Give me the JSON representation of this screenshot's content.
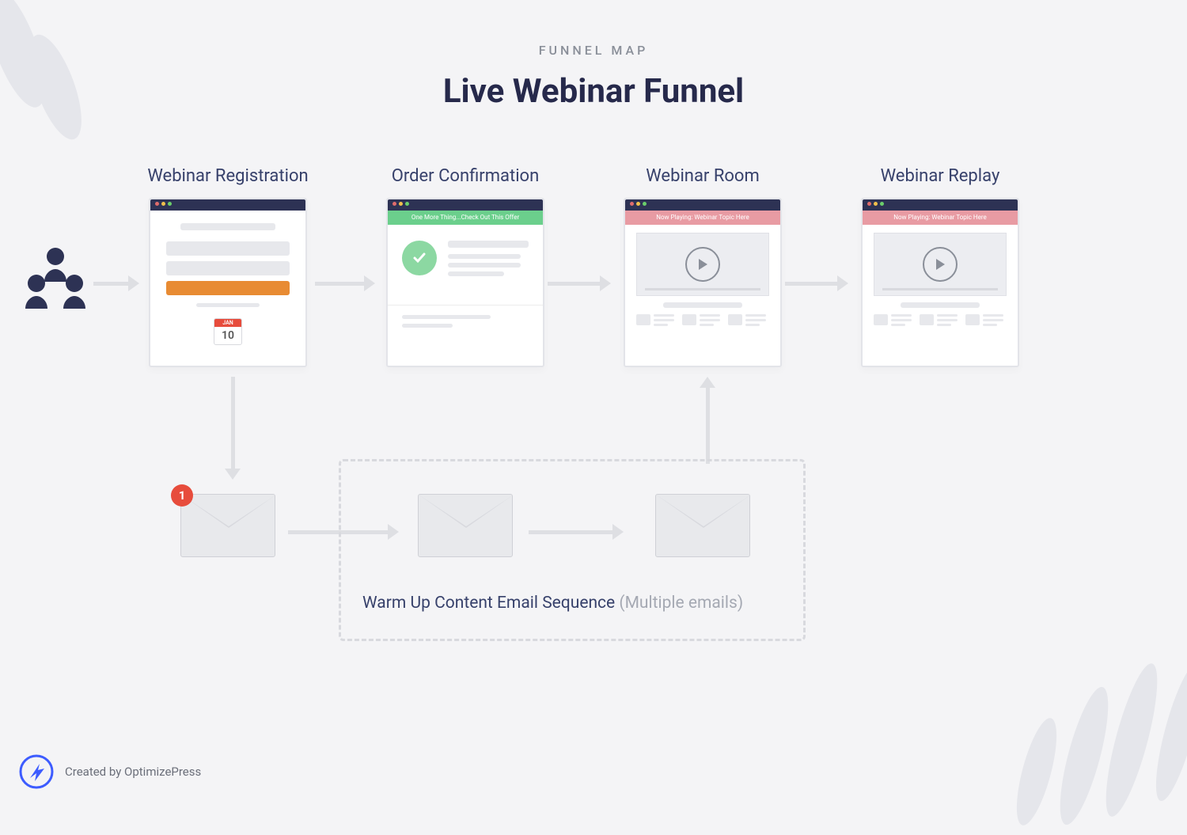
{
  "header": {
    "eyebrow": "FUNNEL MAP",
    "title": "Live Webinar Funnel"
  },
  "stages": {
    "registration": "Webinar Registration",
    "confirmation": "Order Confirmation",
    "room": "Webinar Room",
    "replay": "Webinar Replay"
  },
  "banners": {
    "confirmation": "One More Thing...Check Out This Offer",
    "room": "Now Playing: Webinar Topic Here",
    "replay": "Now Playing: Webinar Topic Here"
  },
  "calendar": {
    "month": "JAN",
    "day": "10"
  },
  "email": {
    "badge": "1"
  },
  "sequence": {
    "label": "Warm Up Content Email Sequence",
    "suffix": "(Multiple emails)"
  },
  "footer": {
    "credit": "Created by OptimizePress"
  }
}
